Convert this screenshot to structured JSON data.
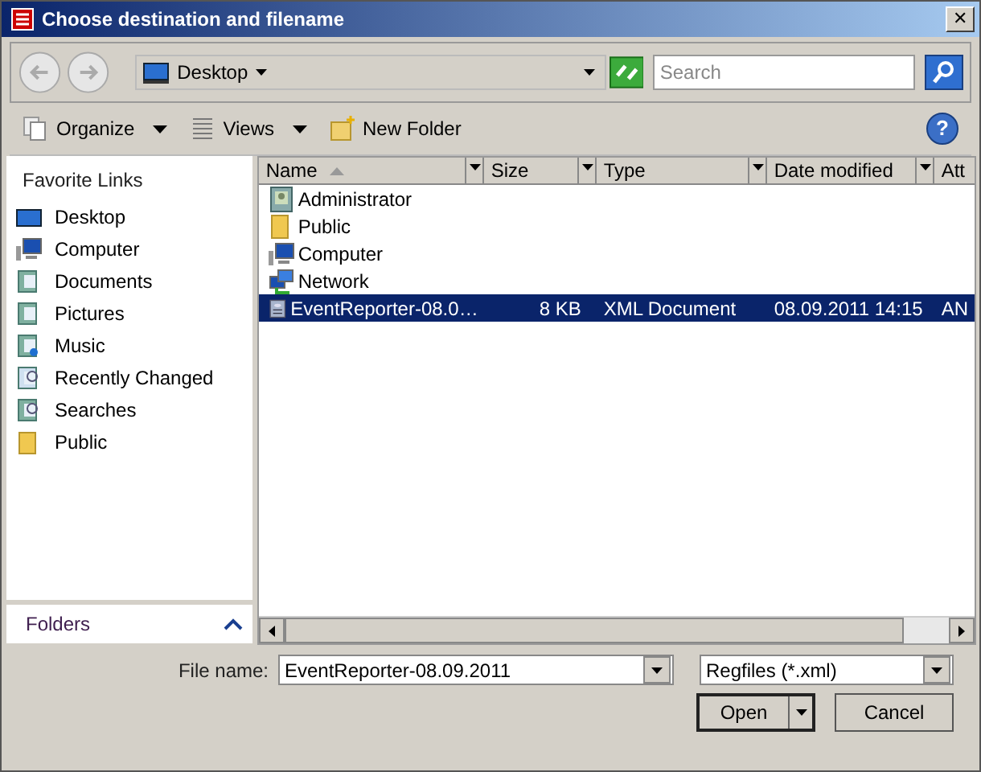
{
  "window": {
    "title": "Choose destination and filename",
    "close": "✕"
  },
  "address": {
    "location": "Desktop",
    "search_placeholder": "Search"
  },
  "toolbar": [
    {
      "label": "Organize",
      "kind": "organize",
      "menu": true
    },
    {
      "label": "Views",
      "kind": "views",
      "menu": true
    },
    {
      "label": "New Folder",
      "kind": "newfolder",
      "menu": false
    }
  ],
  "help": "?",
  "sidebar": {
    "heading": "Favorite Links",
    "items": [
      {
        "label": "Desktop",
        "kind": "desktop"
      },
      {
        "label": "Computer",
        "kind": "computer"
      },
      {
        "label": "Documents",
        "kind": "documents"
      },
      {
        "label": "Pictures",
        "kind": "pictures"
      },
      {
        "label": "Music",
        "kind": "music"
      },
      {
        "label": "Recently Changed",
        "kind": "recent"
      },
      {
        "label": "Searches",
        "kind": "searches"
      },
      {
        "label": "Public",
        "kind": "folder"
      }
    ],
    "folders": "Folders"
  },
  "table": {
    "columns": [
      "Name",
      "Size",
      "Type",
      "Date modified",
      "Att"
    ],
    "rows": [
      {
        "name": "Administrator",
        "kind": "user",
        "selected": false
      },
      {
        "name": "Public",
        "kind": "folder",
        "selected": false
      },
      {
        "name": "Computer",
        "kind": "computer",
        "selected": false
      },
      {
        "name": "Network",
        "kind": "network",
        "selected": false
      },
      {
        "name": "EventReporter-08.0…",
        "kind": "xml",
        "size": "8 KB",
        "type": "XML Document",
        "date": "08.09.2011 14:15",
        "attr": "AN",
        "selected": true
      }
    ]
  },
  "footer": {
    "file_name_label": "File name:",
    "file_name": "EventReporter-08.09.2011",
    "file_type": "Regfiles (*.xml)",
    "open": "Open",
    "cancel": "Cancel"
  }
}
